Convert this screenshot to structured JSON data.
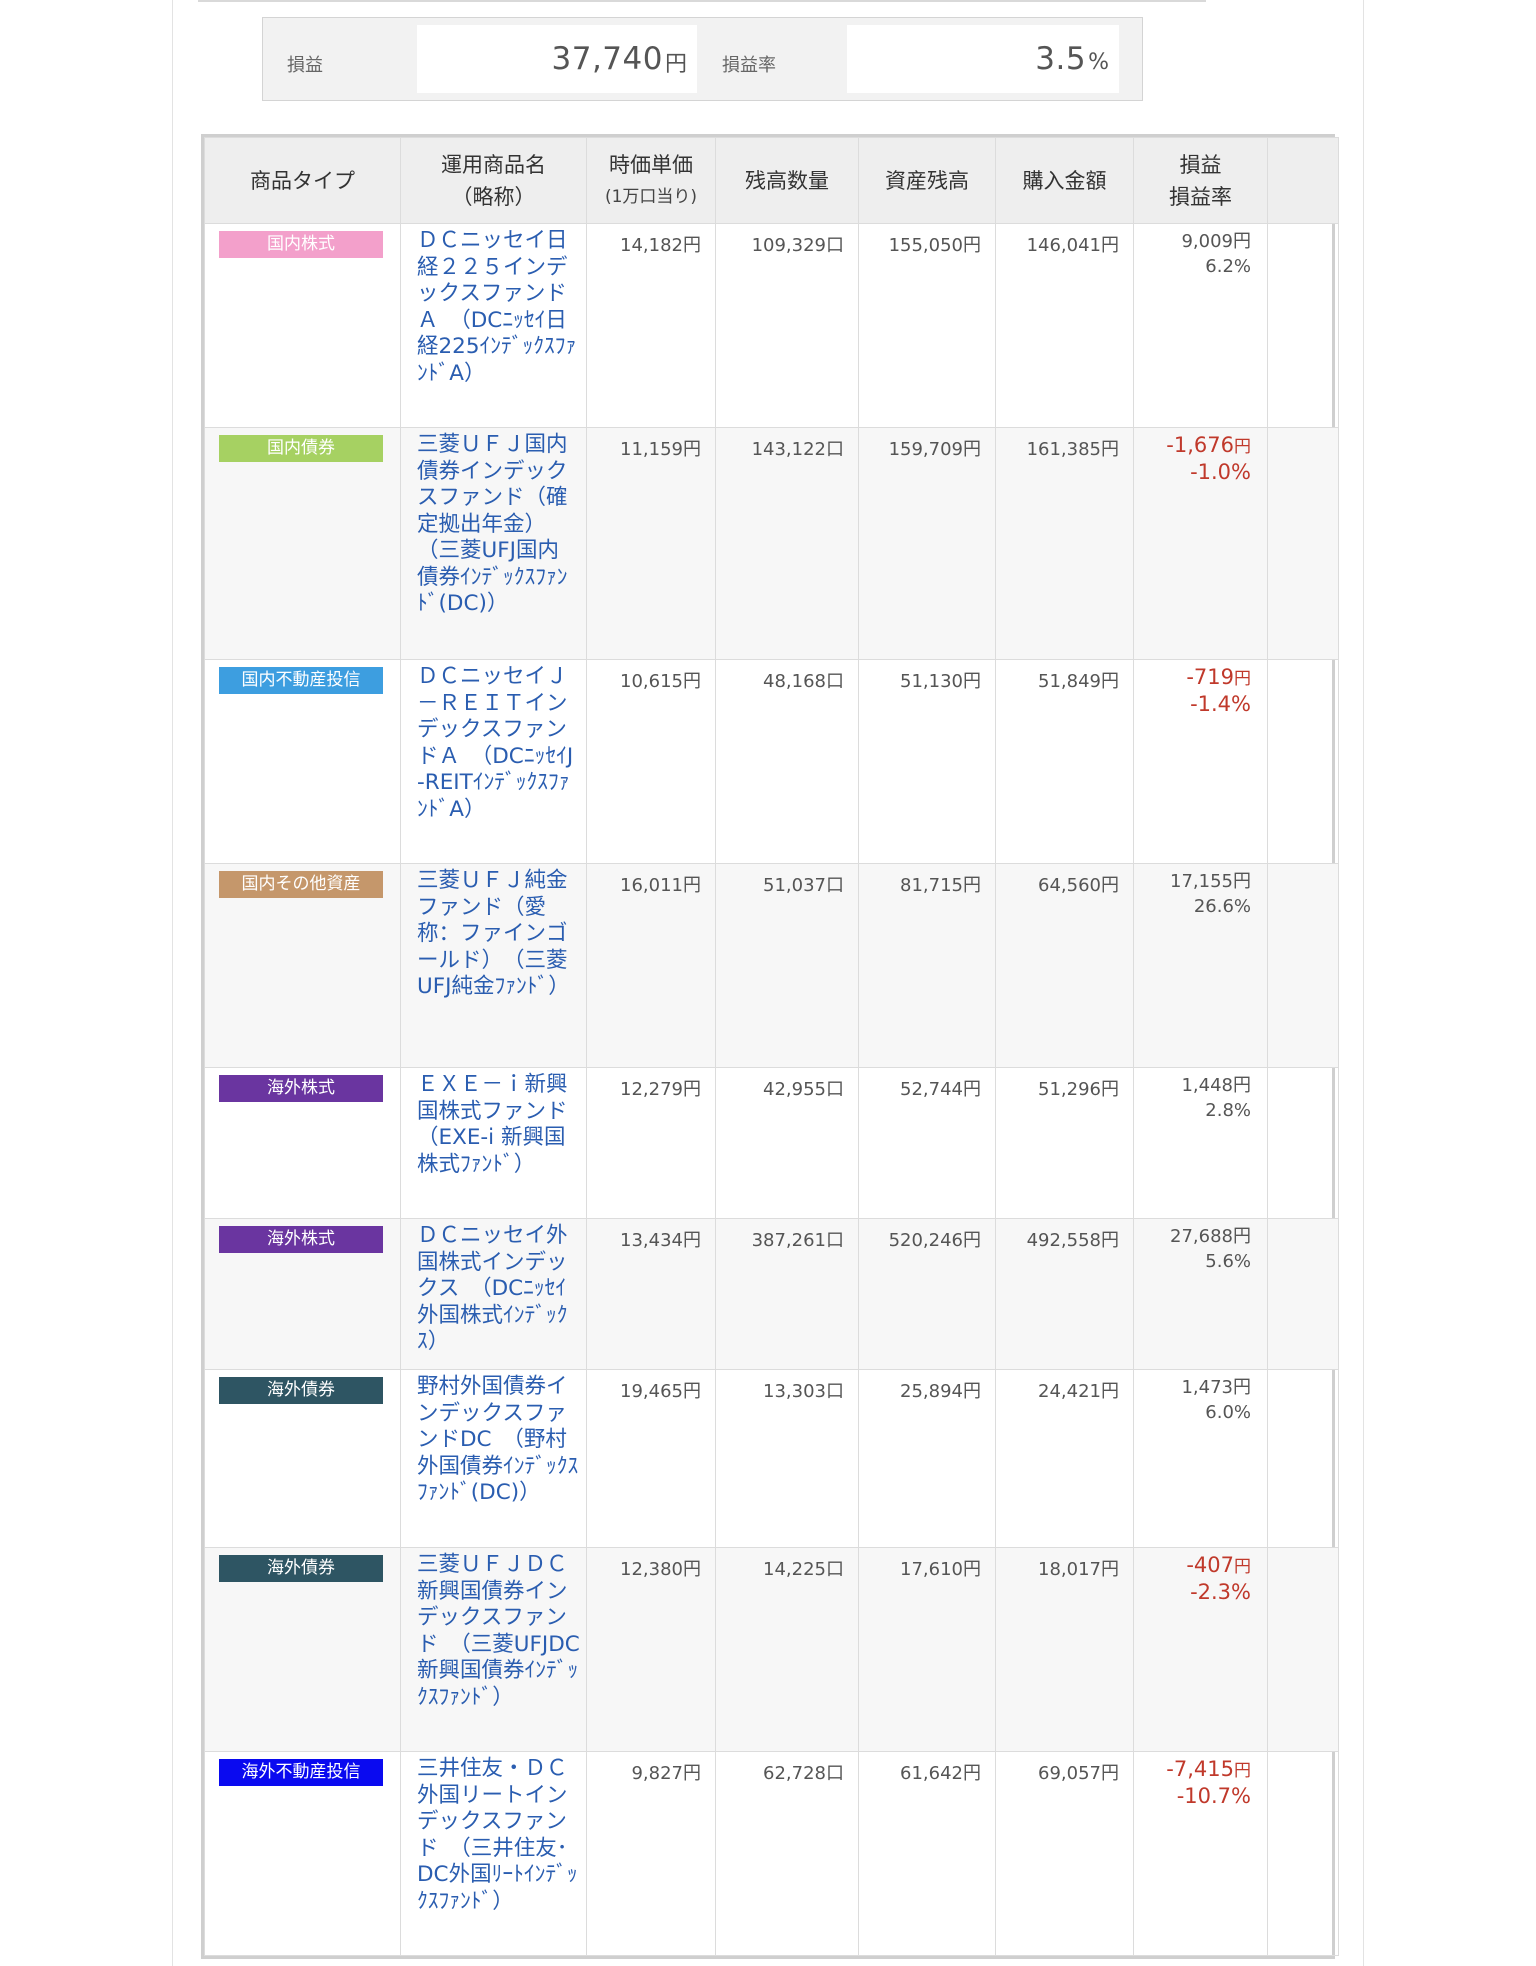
{
  "summary": {
    "profit_label": "損益",
    "profit_value": "37,740",
    "profit_unit": "円",
    "rate_label": "損益率",
    "rate_value": "3.5",
    "rate_unit": "%"
  },
  "table": {
    "headers": {
      "type": "商品タイプ",
      "name_line1": "運用商品名",
      "name_line2": "（略称）",
      "price_line1": "時価単価",
      "price_line2": "(1万口当り)",
      "quantity": "残高数量",
      "balance": "資産残高",
      "purchase": "購入金額",
      "pl_line1": "損益",
      "pl_line2": "損益率"
    },
    "rows": [
      {
        "type": "国内株式",
        "type_color": "#f3a0cb",
        "name": "ＤＣニッセイ日経２２５インデックスファンドＡ　（DCﾆｯｾｲ日経225ｲﾝﾃﾞｯｸｽﾌｧﾝﾄﾞA）",
        "price": "14,182円",
        "quantity": "109,329口",
        "balance": "155,050円",
        "purchase": "146,041円",
        "pl_amount": "9,009",
        "pl_unit": "円",
        "pl_rate": "6.2%",
        "negative": false
      },
      {
        "type": "国内債券",
        "type_color": "#a6d162",
        "name": "三菱ＵＦＪ国内債券インデックスファンド（確定拠出年金）　（三菱UFJ国内債券ｲﾝﾃﾞｯｸｽﾌｧﾝﾄﾞ(DC)）",
        "price": "11,159円",
        "quantity": "143,122口",
        "balance": "159,709円",
        "purchase": "161,385円",
        "pl_amount": "-1,676",
        "pl_unit": "円",
        "pl_rate": "-1.0%",
        "negative": true
      },
      {
        "type": "国内不動産投信",
        "type_color": "#3d9ee0",
        "name": "ＤＣニッセイＪ－ＲＥＩＴインデックスファンドＡ　（DCﾆｯｾｲJ-REITｲﾝﾃﾞｯｸｽﾌｧﾝﾄﾞA）",
        "price": "10,615円",
        "quantity": "48,168口",
        "balance": "51,130円",
        "purchase": "51,849円",
        "pl_amount": "-719",
        "pl_unit": "円",
        "pl_rate": "-1.4%",
        "negative": true
      },
      {
        "type": "国内その他資産",
        "type_color": "#c5976b",
        "name": "三菱ＵＦＪ純金ファンド（愛称：ファインゴールド）　（三菱UFJ純金ﾌｧﾝﾄﾞ）",
        "price": "16,011円",
        "quantity": "51,037口",
        "balance": "81,715円",
        "purchase": "64,560円",
        "pl_amount": "17,155",
        "pl_unit": "円",
        "pl_rate": "26.6%",
        "negative": false
      },
      {
        "type": "海外株式",
        "type_color": "#6a35a0",
        "name": "ＥＸＥ－ｉ新興国株式ファンド　（EXE-i 新興国株式ﾌｧﾝﾄﾞ）",
        "price": "12,279円",
        "quantity": "42,955口",
        "balance": "52,744円",
        "purchase": "51,296円",
        "pl_amount": "1,448",
        "pl_unit": "円",
        "pl_rate": "2.8%",
        "negative": false
      },
      {
        "type": "海外株式",
        "type_color": "#6a35a0",
        "name": "ＤＣニッセイ外国株式インデックス　（DCﾆｯｾｲ外国株式ｲﾝﾃﾞｯｸｽ）",
        "price": "13,434円",
        "quantity": "387,261口",
        "balance": "520,246円",
        "purchase": "492,558円",
        "pl_amount": "27,688",
        "pl_unit": "円",
        "pl_rate": "5.6%",
        "negative": false
      },
      {
        "type": "海外債券",
        "type_color": "#2e5563",
        "name": "野村外国債券インデックスファンドDC　（野村外国債券ｲﾝﾃﾞｯｸｽﾌｧﾝﾄﾞ(DC)）",
        "price": "19,465円",
        "quantity": "13,303口",
        "balance": "25,894円",
        "purchase": "24,421円",
        "pl_amount": "1,473",
        "pl_unit": "円",
        "pl_rate": "6.0%",
        "negative": false
      },
      {
        "type": "海外債券",
        "type_color": "#2e5563",
        "name": "三菱ＵＦＪＤＣ新興国債券インデックスファンド　（三菱UFJDC新興国債券ｲﾝﾃﾞｯｸｽﾌｧﾝﾄﾞ）",
        "price": "12,380円",
        "quantity": "14,225口",
        "balance": "17,610円",
        "purchase": "18,017円",
        "pl_amount": "-407",
        "pl_unit": "円",
        "pl_rate": "-2.3%",
        "negative": true
      },
      {
        "type": "海外不動産投信",
        "type_color": "#0a0af0",
        "name": "三井住友・ＤＣ外国リートインデックスファンド　（三井住友･DC外国ﾘｰﾄｲﾝﾃﾞｯｸｽﾌｧﾝﾄﾞ）",
        "price": "9,827円",
        "quantity": "62,728口",
        "balance": "61,642円",
        "purchase": "69,057円",
        "pl_amount": "-7,415",
        "pl_unit": "円",
        "pl_rate": "-10.7%",
        "negative": true
      }
    ]
  }
}
